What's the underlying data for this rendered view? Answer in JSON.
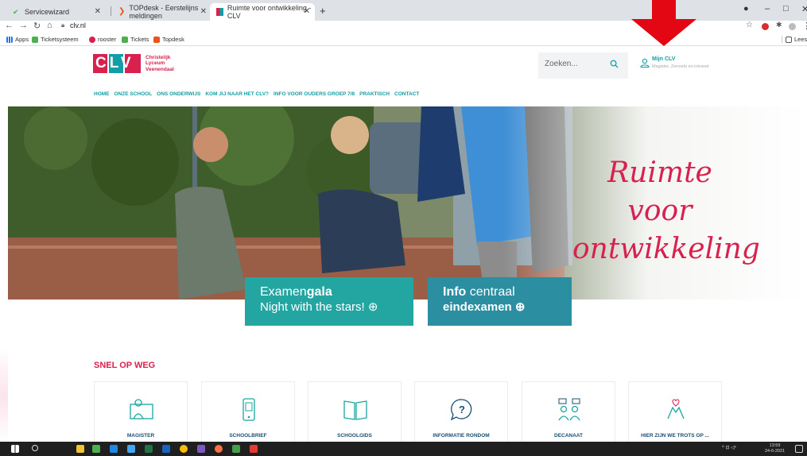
{
  "browser": {
    "tabs": [
      {
        "title": "Servicewizard"
      },
      {
        "title": "TOPdesk - Eerstelijns meldingen"
      },
      {
        "title": "Ruimte voor ontwikkeling - CLV"
      }
    ],
    "new_tab": "+",
    "url": "clv.nl",
    "bookmarks": [
      "Apps",
      "Ticketsysteem",
      "rooster",
      "Tickets",
      "Topdesk"
    ],
    "reading_list": "Leeslijst",
    "window_controls": [
      "–",
      "□",
      "✕"
    ]
  },
  "site": {
    "logo_text_lines": [
      "Christelijk",
      "Lyceum",
      "Veenendaal"
    ],
    "logo_mark": "CLV",
    "search_placeholder": "Zoeken...",
    "account_title": "Mijn CLV",
    "account_subtitle": "Magister, Zermelo en intranet",
    "menu": [
      "HOME",
      "ONZE SCHOOL",
      "ONS ONDERWIJS",
      "KOM JIJ NAAR HET CLV?",
      "INFO VOOR OUDERS GROEP 7/8",
      "PRAKTISCH",
      "CONTACT"
    ],
    "hero_tagline_line1": "Ruimte voor",
    "hero_tagline_line2": "ontwikkeling",
    "cta1_line1_pre": "Examen",
    "cta1_line1_bold": "gala",
    "cta1_line2": "Night with the stars! ⊕",
    "cta2_line1_bold": "Info",
    "cta2_line1_rest": " centraal",
    "cta2_line2": "eindexamen ⊕",
    "quick_title": "SNEL OP WEG",
    "quick_links": [
      "MAGISTER",
      "SCHOOLBRIEF",
      "SCHOOLGIDS",
      "INFORMATIE RONDOM",
      "DECANAAT",
      "HIER ZIJN WE TROTS OP ..."
    ]
  },
  "taskbar": {
    "time": "13:59",
    "date": "24-6-2021"
  },
  "colors": {
    "brand_teal": "#129ea6",
    "brand_pink": "#d8214f",
    "cta_teal": "#23a6a2",
    "cta_blue": "#2c8ea1",
    "arrow_red": "#e30613"
  }
}
